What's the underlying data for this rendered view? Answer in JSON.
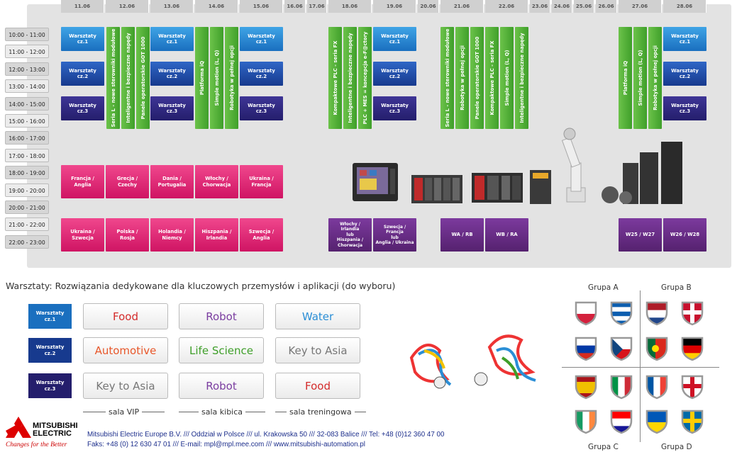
{
  "dates": [
    "11.06",
    "12.06",
    "13.06",
    "14.06",
    "15.06",
    "16.06",
    "17.06",
    "18.06",
    "19.06",
    "20.06",
    "21.06",
    "22.06",
    "23.06",
    "24.06",
    "25.06",
    "26.06",
    "27.06",
    "28.06"
  ],
  "times": [
    "10:00 - 11:00",
    "11:00 - 12:00",
    "12:00 - 13:00",
    "13:00 - 14:00",
    "14:00 - 15:00",
    "15:00 - 16:00",
    "16:00 - 17:00",
    "17:00 - 18:00",
    "18:00 - 19:00",
    "19:00 - 20:00",
    "20:00 - 21:00",
    "21:00 - 22:00",
    "22:00 - 23:00"
  ],
  "workshop_labels": {
    "w1": "Warsztaty\ncz.1",
    "w2": "Warsztaty\ncz.2",
    "w3": "Warsztaty\ncz.3"
  },
  "sessions": {
    "d1106": [
      "Seria L - nowe sterowniki modułowe",
      "Inteligentne i bezpieczne napędy",
      "Panele operatorskie GOT 1000"
    ],
    "d1406": [
      "Platforma iQ",
      "Simple motion (L, Q)",
      "Robotyka w pełnej opcji"
    ],
    "d1806": [
      "Kompaktowe PLC - seria FX",
      "Inteligentne i bezpieczne napędy",
      "PLC + MES = koncepcja e-F@ctory"
    ],
    "d2106": [
      "Seria L - nowe sterowniki modułowe",
      "Robotyka w pełnej opcji",
      "Panele operatorskie GOT 1000",
      "Kompaktowe PLC - seria FX",
      "Simple motion (L, Q)",
      "Inteligentne i bezpieczne napędy"
    ],
    "d2706": [
      "Platforma iQ",
      "Simple motion (L, Q)",
      "Robotyka w pełnej opcji"
    ]
  },
  "matches_evening": [
    "Francja /\nAnglia",
    "Grecja /\nCzechy",
    "Dania /\nPortugalia",
    "Włochy /\nChorwacja",
    "Ukraina /\nFrancja"
  ],
  "matches_late": [
    "Ukraina /\nSzwecja",
    "Polska /\nRosja",
    "Holandia /\nNiemcy",
    "Hiszpania /\nIrlandia",
    "Szwecja /\nAnglia"
  ],
  "knockout": {
    "k1": "Włochy / Irlandia\nlub\nHiszpania /\nChorwacja",
    "k2": "Szwecja / Francja\nlub\nAnglia / Ukraina",
    "wa": "WA / RB",
    "wb": "WB / RA",
    "w25": "W25 / W27",
    "w26": "W26 / W28"
  },
  "workshops": {
    "title": "Warsztaty: Rozwiązania dedykowane dla kluczowych przemysłów i aplikacji (do wyboru)",
    "rows": [
      [
        "Food",
        "Robot",
        "Water"
      ],
      [
        "Automotive",
        "Life Science",
        "Key to Asia"
      ],
      [
        "Key to Asia",
        "Robot",
        "Food"
      ]
    ],
    "colors": [
      [
        "#d42b2b",
        "#7a3da0",
        "#2a8ed6"
      ],
      [
        "#e8572a",
        "#3f9f2a",
        "#777777"
      ],
      [
        "#777777",
        "#7a3da0",
        "#d42b2b"
      ]
    ],
    "rooms": [
      "sala VIP",
      "sala kibica",
      "sala treningowa"
    ]
  },
  "groups": [
    "Grupa A",
    "Grupa B",
    "Grupa C",
    "Grupa D"
  ],
  "colors": {
    "w1": "#1a6fbf",
    "w2": "#173a8e",
    "w3": "#241e6c",
    "pink": "#cf1463",
    "green": "#3f9f2a",
    "purple": "#55216f",
    "footer": "#1d2f8c"
  },
  "footer": {
    "brand_line1": "MITSUBISHI",
    "brand_line2": "ELECTRIC",
    "tagline": "Changes for the Better",
    "line1": "Mitsubishi Electric Europe B.V. /// Oddział w Polsce /// ul. Krakowska 50 /// 32-083 Balice ///  Tel: +48 (0)12 360 47 00",
    "line2": "Faks: +48 (0) 12 630 47 01 /// E-mail: mpl@mpl.mee.com /// www.mitsubishi-automation.pl"
  }
}
